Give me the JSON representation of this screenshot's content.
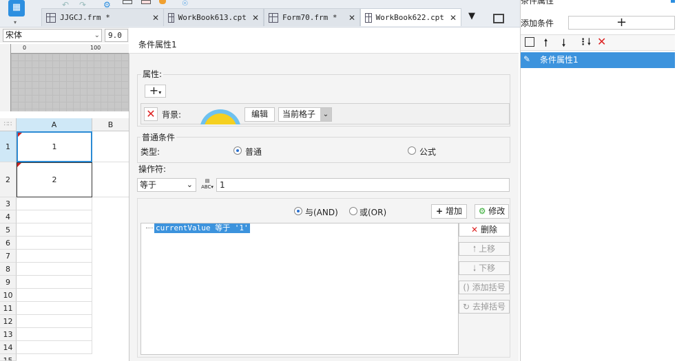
{
  "tabs": [
    {
      "label": "JJGCJ.frm *",
      "active": false
    },
    {
      "label": "WorkBook613.cpt",
      "active": false
    },
    {
      "label": "Form70.frm *",
      "active": false
    },
    {
      "label": "WorkBook622.cpt",
      "active": true
    }
  ],
  "toolbar": {
    "font_name": "宋体",
    "font_size": "9.0"
  },
  "ruler": {
    "mark_0": "0",
    "mark_100": "100"
  },
  "sheet": {
    "columns": [
      "A",
      "B"
    ],
    "rows": [
      "1",
      "2",
      "3",
      "4",
      "5",
      "6",
      "7",
      "8",
      "9",
      "10",
      "11",
      "12",
      "13",
      "14",
      "15"
    ],
    "cells": {
      "a1": "1",
      "a2": "2"
    }
  },
  "dialog": {
    "title": "条件属性1",
    "attributes": {
      "label": "属性:",
      "add_icon": "+",
      "background_label": "背景:",
      "edit_button": "编辑",
      "scope_value": "当前格子"
    },
    "common": {
      "label": "普通条件",
      "type_label": "类型:",
      "type_options": [
        {
          "label": "普通",
          "checked": true
        },
        {
          "label": "公式",
          "checked": false
        }
      ],
      "operator_label": "操作符:",
      "operator_value": "等于",
      "value": "1"
    },
    "logic": {
      "and_label": "与(AND)",
      "or_label": "或(OR)",
      "and_checked": true
    },
    "add_button": "增加",
    "modify_button": "修改",
    "condition_text": "currentValue 等于 '1'",
    "side_buttons": [
      "删除",
      "上移",
      "下移",
      "添加括号",
      "去掉括号"
    ]
  },
  "right_panel": {
    "title": "条件属性",
    "add_label": "添加条件",
    "add_button": "+",
    "items": [
      "条件属性1"
    ]
  }
}
